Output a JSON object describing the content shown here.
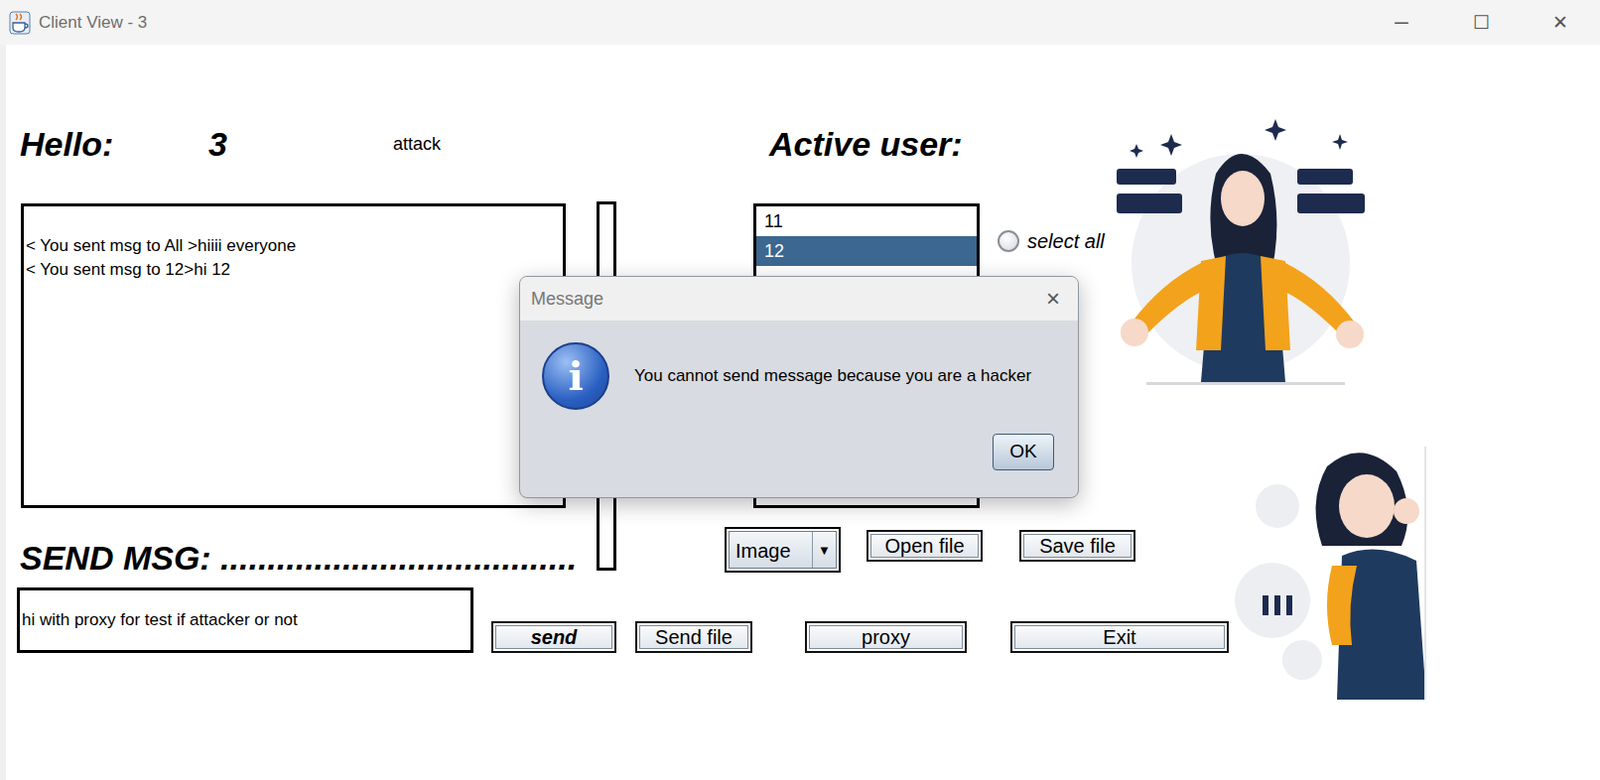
{
  "window": {
    "title": "Client View - 3",
    "controls": [
      "─",
      "☐",
      "✕"
    ]
  },
  "greeting": {
    "label": "Hello:",
    "user": "3",
    "mode": "attack"
  },
  "chat": {
    "lines": [
      "< You sent msg to All >hiiii everyone",
      "< You sent msg to 12>hi 12"
    ]
  },
  "active_users": {
    "label": "Active user:",
    "items": [
      {
        "name": "11",
        "selected": false
      },
      {
        "name": "12",
        "selected": true
      }
    ]
  },
  "select_all": {
    "label": "select all",
    "checked": false
  },
  "send_area": {
    "label": "SEND MSG: ......................................",
    "input_value": "hi with proxy for test if attacker or not",
    "file_type": "Image",
    "file_type_arrow": "▼"
  },
  "file_buttons": [
    "Open file",
    "Save file"
  ],
  "action_buttons": [
    "send",
    "Send file",
    "proxy",
    "Exit"
  ],
  "dialog": {
    "title": "Message",
    "close": "×",
    "icon": "i",
    "message": "You cannot send message because you are a hacker",
    "button": "OK"
  }
}
